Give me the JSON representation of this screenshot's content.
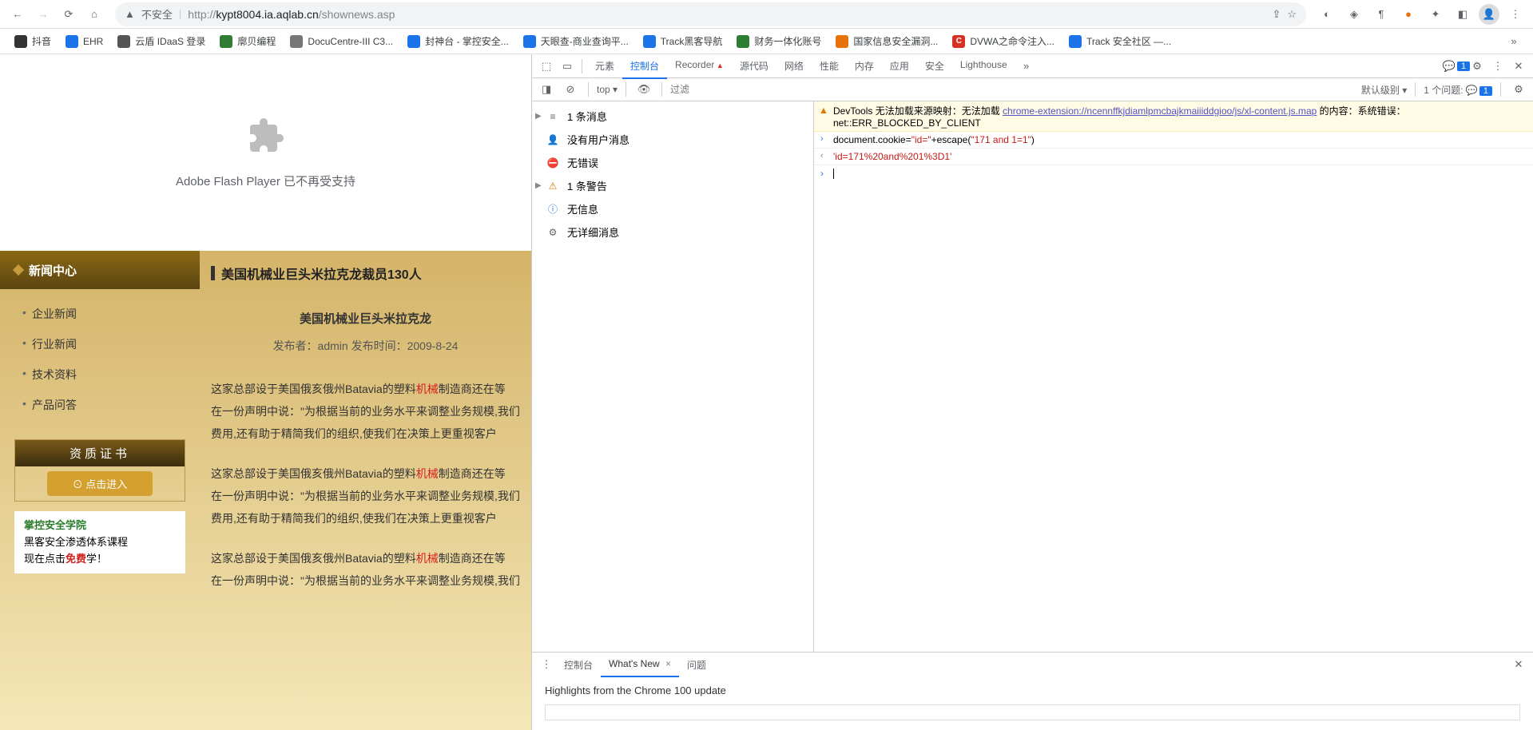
{
  "browser": {
    "url_proto": "http://",
    "url_host": "kypt8004.ia.aqlab.cn",
    "url_path": "/shownews.asp",
    "insecure": "不安全",
    "share_icon": "share-icon"
  },
  "bookmarks": [
    {
      "label": "抖音",
      "bg": "#333"
    },
    {
      "label": "EHR",
      "bg": "#1a73e8"
    },
    {
      "label": "云盾 IDaaS 登录",
      "bg": "#555"
    },
    {
      "label": "廓贝编程",
      "bg": "#2e7d32"
    },
    {
      "label": "DocuCentre-III C3...",
      "bg": "#777"
    },
    {
      "label": "封神台 - 掌控安全...",
      "bg": "#1a73e8"
    },
    {
      "label": "天眼查-商业查询平...",
      "bg": "#1a73e8"
    },
    {
      "label": "Track黑客导航",
      "bg": "#1a73e8"
    },
    {
      "label": "财务一体化账号",
      "bg": "#2e7d32"
    },
    {
      "label": "国家信息安全漏洞...",
      "bg": "#e8710a"
    },
    {
      "label": "DVWA之命令注入...",
      "bg": "#d93025",
      "txt": "C"
    },
    {
      "label": "Track 安全社区 —...",
      "bg": "#1a73e8"
    }
  ],
  "flash": {
    "msg": "Adobe Flash Player 已不再受支持"
  },
  "site": {
    "nav_title": "新闻中心",
    "menu": [
      "企业新闻",
      "行业新闻",
      "技术资料",
      "产品问答"
    ],
    "cert_title": "资质证书",
    "cert_btn": "⊙ 点击进入",
    "ad_l1a": "掌控安全学院",
    "ad_l2": "黑客安全渗透体系课程",
    "ad_l3a": "现在点击",
    "ad_l3b": "免费",
    "ad_l3c": "学！",
    "article_title": "美国机械业巨头米拉克龙裁员130人",
    "article_sub": "美国机械业巨头米拉克龙",
    "article_meta": "发布者：admin 发布时间：2009-8-24",
    "p1a": "这家总部设于美国俄亥俄州Batavia的塑料",
    "p1b": "机械",
    "p1c": "制造商还在等",
    "p2": "在一份声明中说：\"为根据当前的业务水平来调整业务规模,我们",
    "p3": "费用,还有助于精简我们的组织,使我们在决策上更重视客户"
  },
  "dt": {
    "tabs": [
      "元素",
      "控制台",
      "Recorder",
      "源代码",
      "网络",
      "性能",
      "内存",
      "应用",
      "安全",
      "Lighthouse"
    ],
    "active": 1,
    "badge": "1",
    "context": "top ▾",
    "filter_ph": "过滤",
    "level": "默认级别 ▾",
    "issues_label": "1 个问题:",
    "msgs": [
      {
        "icon": "list",
        "txt": "1 条消息",
        "arrow": true
      },
      {
        "icon": "user",
        "txt": "没有用户消息"
      },
      {
        "icon": "err",
        "txt": "无错误"
      },
      {
        "icon": "warn",
        "txt": "1 条警告",
        "arrow": true
      },
      {
        "icon": "info",
        "txt": "无信息"
      },
      {
        "icon": "verbose",
        "txt": "无详细消息"
      }
    ],
    "warn_pre": "DevTools 无法加载来源映射：无法加载 ",
    "warn_link": "chrome-extension://ncennffkjdiamlpmcbajkmaiiiddgioo/js/xl-content.js.map",
    "warn_post": " 的内容：系统错误：net::ERR_BLOCKED_BY_CLIENT",
    "cmd_a": "document.cookie=",
    "cmd_b": "\"id=\"",
    "cmd_c": "+escape(",
    "cmd_d": "\"171 and 1=1\"",
    "cmd_e": ")",
    "result": "'id=171%20and%201%3D1'",
    "drawer_tabs": [
      "控制台",
      "What's New",
      "问题"
    ],
    "drawer_active": 1,
    "drawer_title": "Highlights from the Chrome 100 update"
  }
}
